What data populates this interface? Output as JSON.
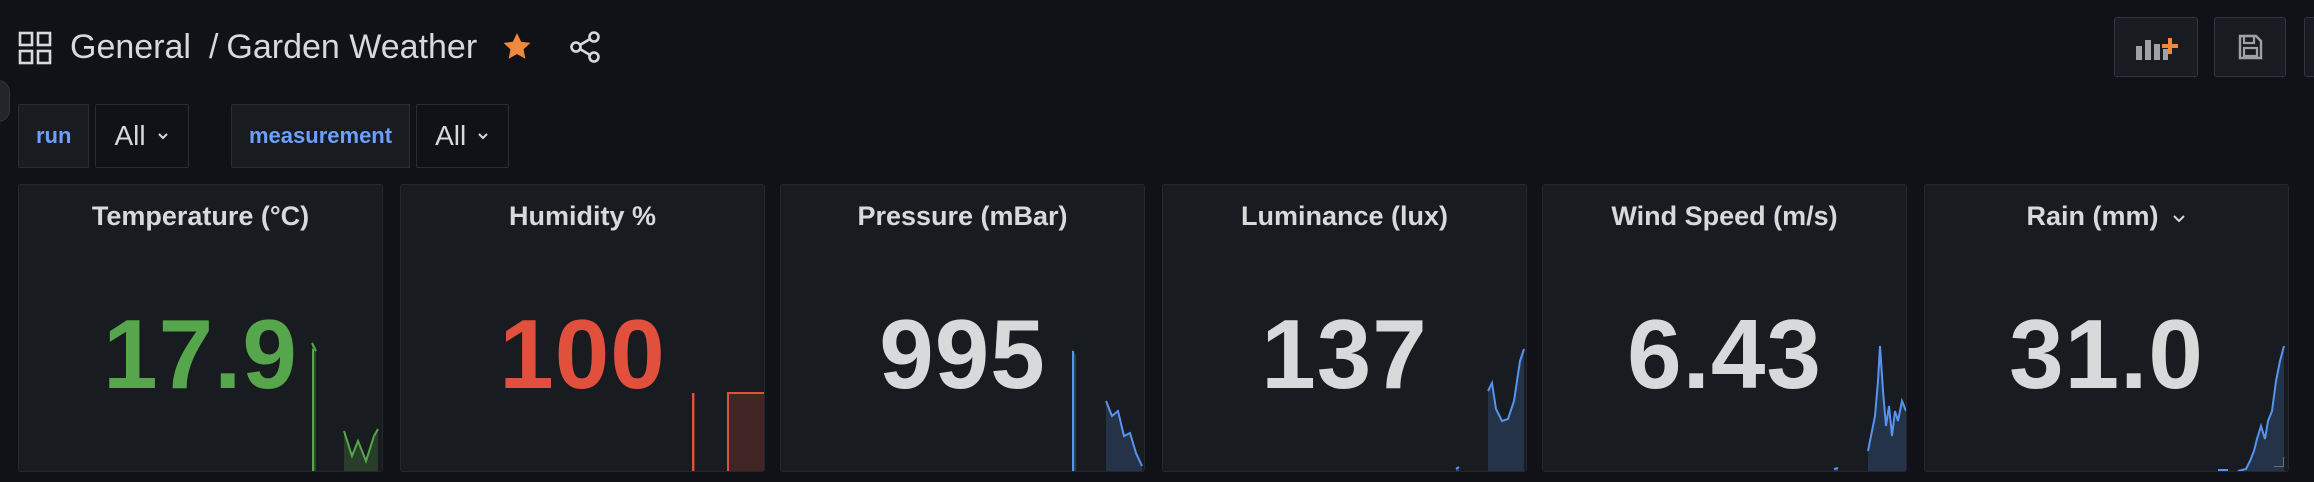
{
  "breadcrumb": {
    "folder": "General",
    "separator": "/",
    "dashboard": "Garden Weather"
  },
  "variables": [
    {
      "label": "run",
      "value": "All"
    },
    {
      "label": "measurement",
      "value": "All"
    }
  ],
  "colors": {
    "background": "#111217",
    "panel": "#181b1f",
    "accent_blue": "#6e9fff",
    "green": "#56a64b",
    "red": "#e0503c",
    "neutral": "#d8d9da",
    "star": "#f0883e",
    "spark_blue": "#5794f2"
  },
  "toolbar": {
    "add_panel_icon": "add-panel-icon",
    "save_icon": "save-icon"
  },
  "panels": [
    {
      "title": "Temperature (°C)",
      "value": "17.9",
      "color": "#56a64b"
    },
    {
      "title": "Humidity %",
      "value": "100",
      "color": "#e0503c"
    },
    {
      "title": "Pressure (mBar)",
      "value": "995",
      "color": "#d8d9da"
    },
    {
      "title": "Luminance (lux)",
      "value": "137",
      "color": "#d8d9da"
    },
    {
      "title": "Wind Speed (m/s)",
      "value": "6.43",
      "color": "#d8d9da"
    },
    {
      "title": "Rain (mm)",
      "value": "31.0",
      "color": "#d8d9da"
    }
  ]
}
